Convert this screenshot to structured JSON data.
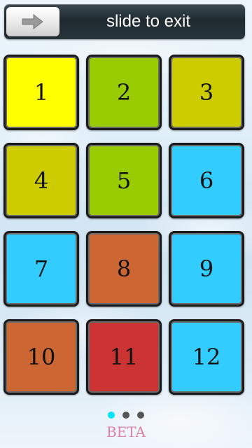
{
  "slider": {
    "label": "slide to exit",
    "handle_icon": "right-arrow-icon"
  },
  "tiles": [
    {
      "label": "1",
      "color": "#ffff00"
    },
    {
      "label": "2",
      "color": "#99cc00"
    },
    {
      "label": "3",
      "color": "#cccc00"
    },
    {
      "label": "4",
      "color": "#cccc00"
    },
    {
      "label": "5",
      "color": "#99cc00"
    },
    {
      "label": "6",
      "color": "#33ccff"
    },
    {
      "label": "7",
      "color": "#33ccff"
    },
    {
      "label": "8",
      "color": "#cc6633"
    },
    {
      "label": "9",
      "color": "#33ccff"
    },
    {
      "label": "10",
      "color": "#cc6633"
    },
    {
      "label": "11",
      "color": "#cc3333"
    },
    {
      "label": "12",
      "color": "#33ccff"
    }
  ],
  "pager": {
    "pages": 3,
    "current": 1,
    "active_color": "#00e5ff",
    "inactive_color": "#555555"
  },
  "footer": {
    "label": "BETA"
  }
}
